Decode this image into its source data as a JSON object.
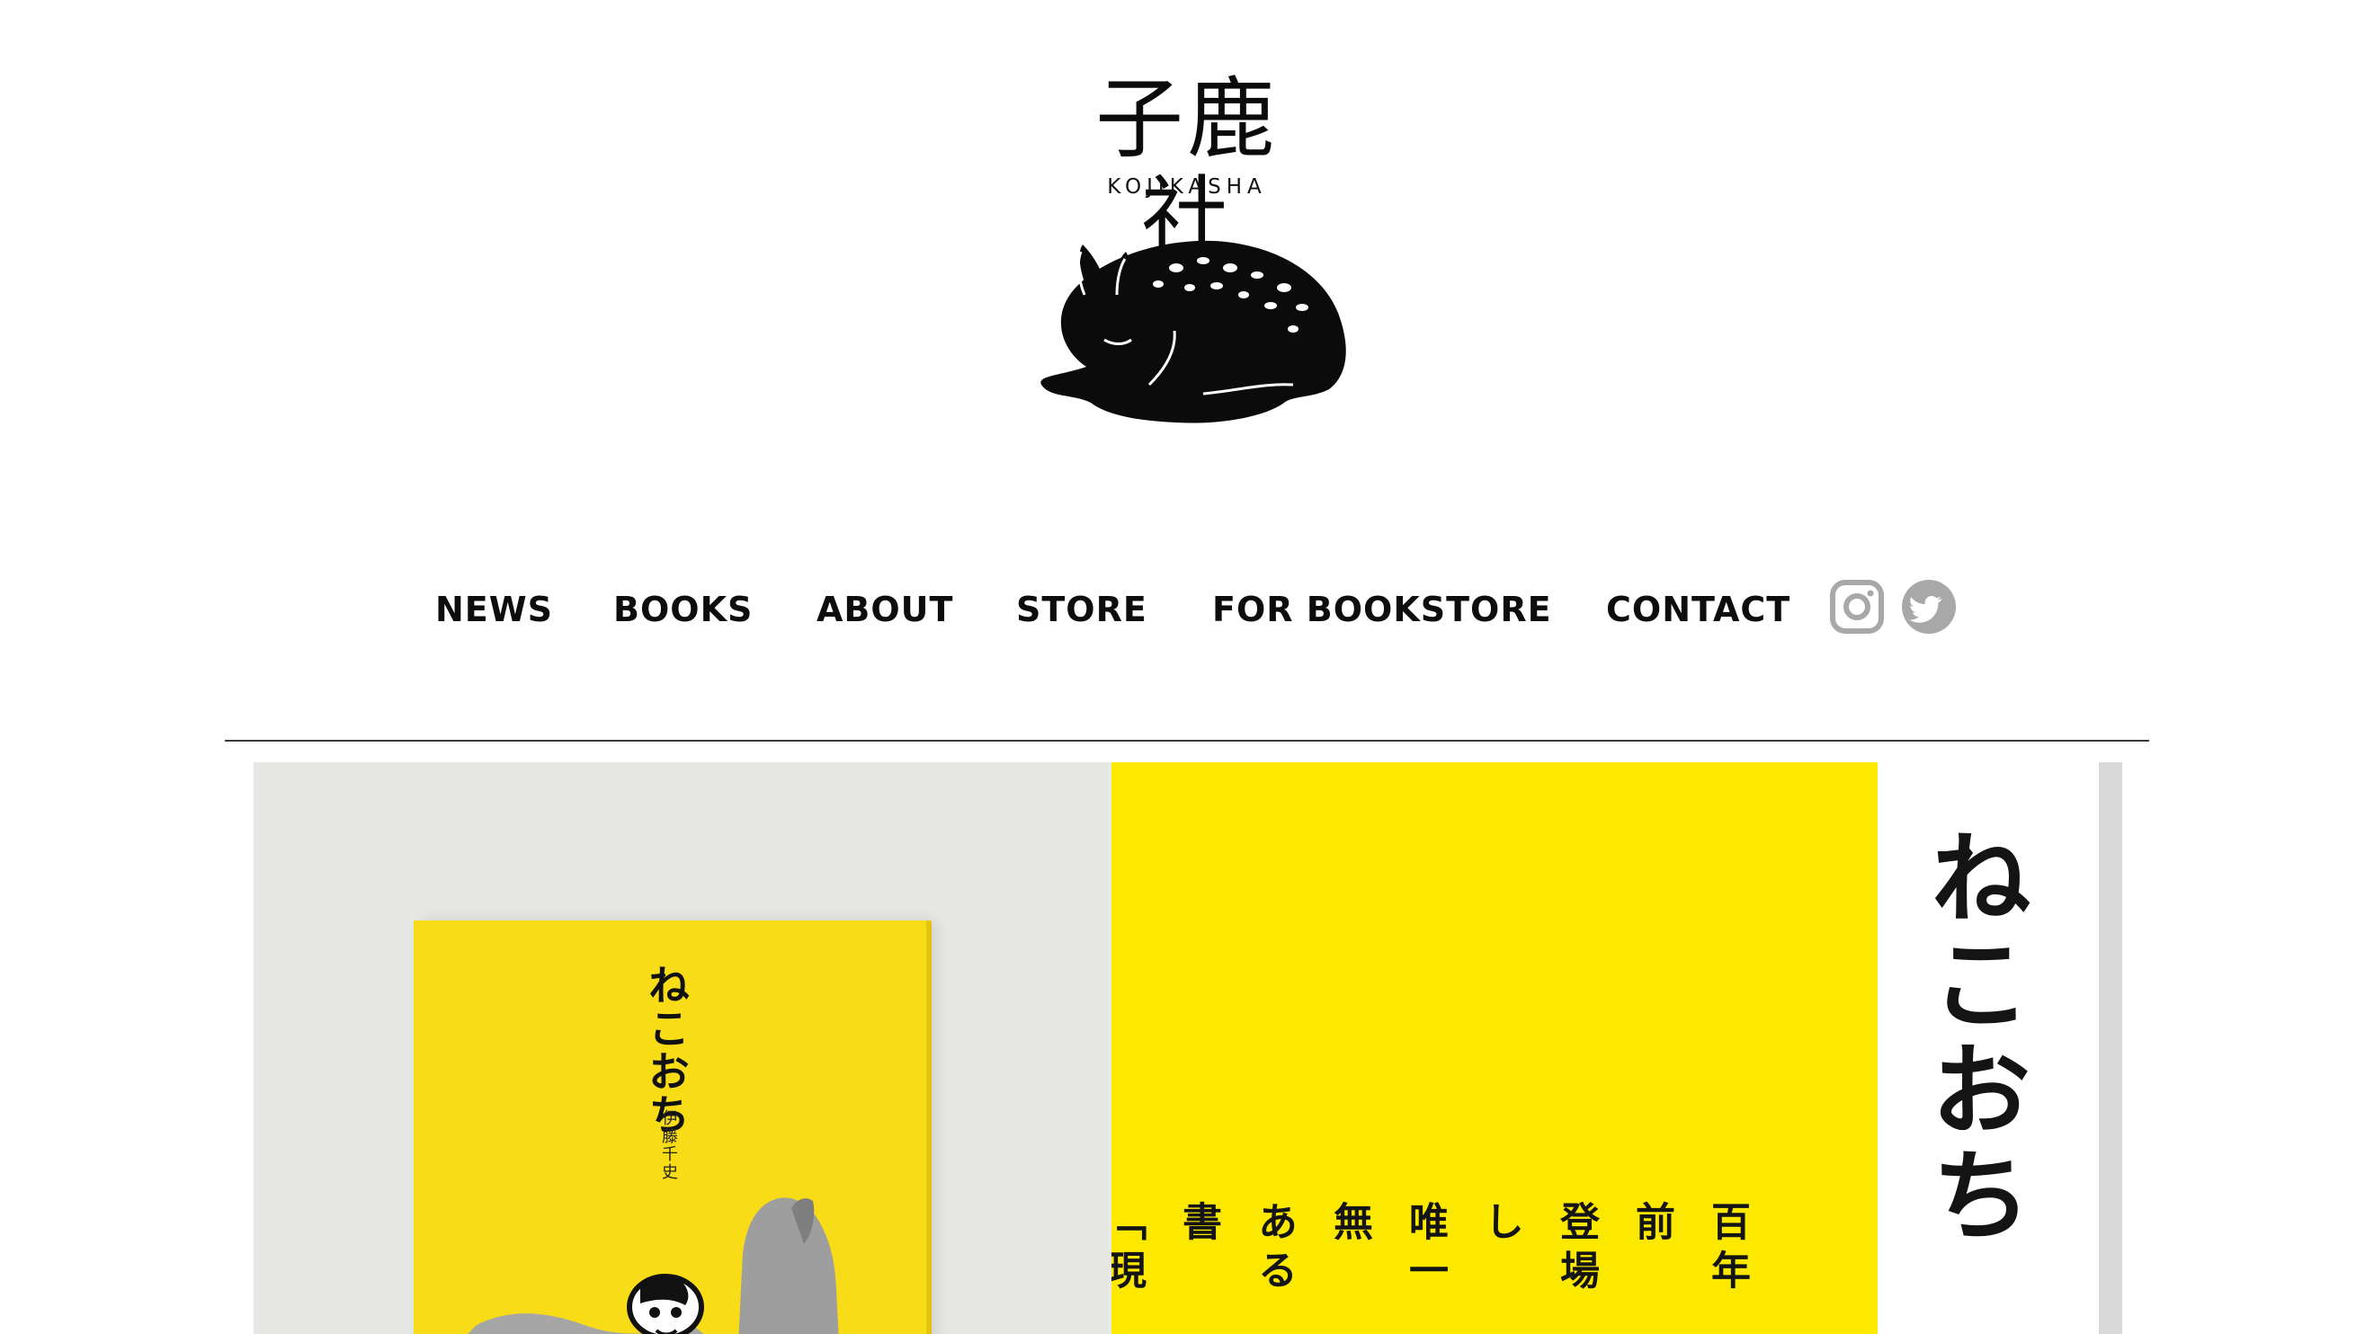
{
  "logo": {
    "title": "子鹿社",
    "subtitle": "KOJIKASHA",
    "mark_icon": "sleeping-fawn-illustration"
  },
  "nav": {
    "items": [
      {
        "label": "NEWS"
      },
      {
        "label": "BOOKS"
      },
      {
        "label": "ABOUT"
      },
      {
        "label": "STORE"
      },
      {
        "label": "FOR BOOKSTORE"
      },
      {
        "label": "CONTACT"
      }
    ],
    "social": [
      {
        "icon": "instagram-icon",
        "color": "#a8a8a8"
      },
      {
        "icon": "twitter-icon",
        "color": "#a8a8a8"
      }
    ]
  },
  "hero": {
    "book_title": "ねこおち",
    "book_author": "伊藤千史",
    "side_title": "ねこおち",
    "text": "百年前\n登場し\n唯一無\nある書\n「現代の\n言われ\nまさに",
    "colors": {
      "accent": "#fde800",
      "photo_bg": "#e7e8e6",
      "side_bar": "#d9d9d9"
    }
  }
}
